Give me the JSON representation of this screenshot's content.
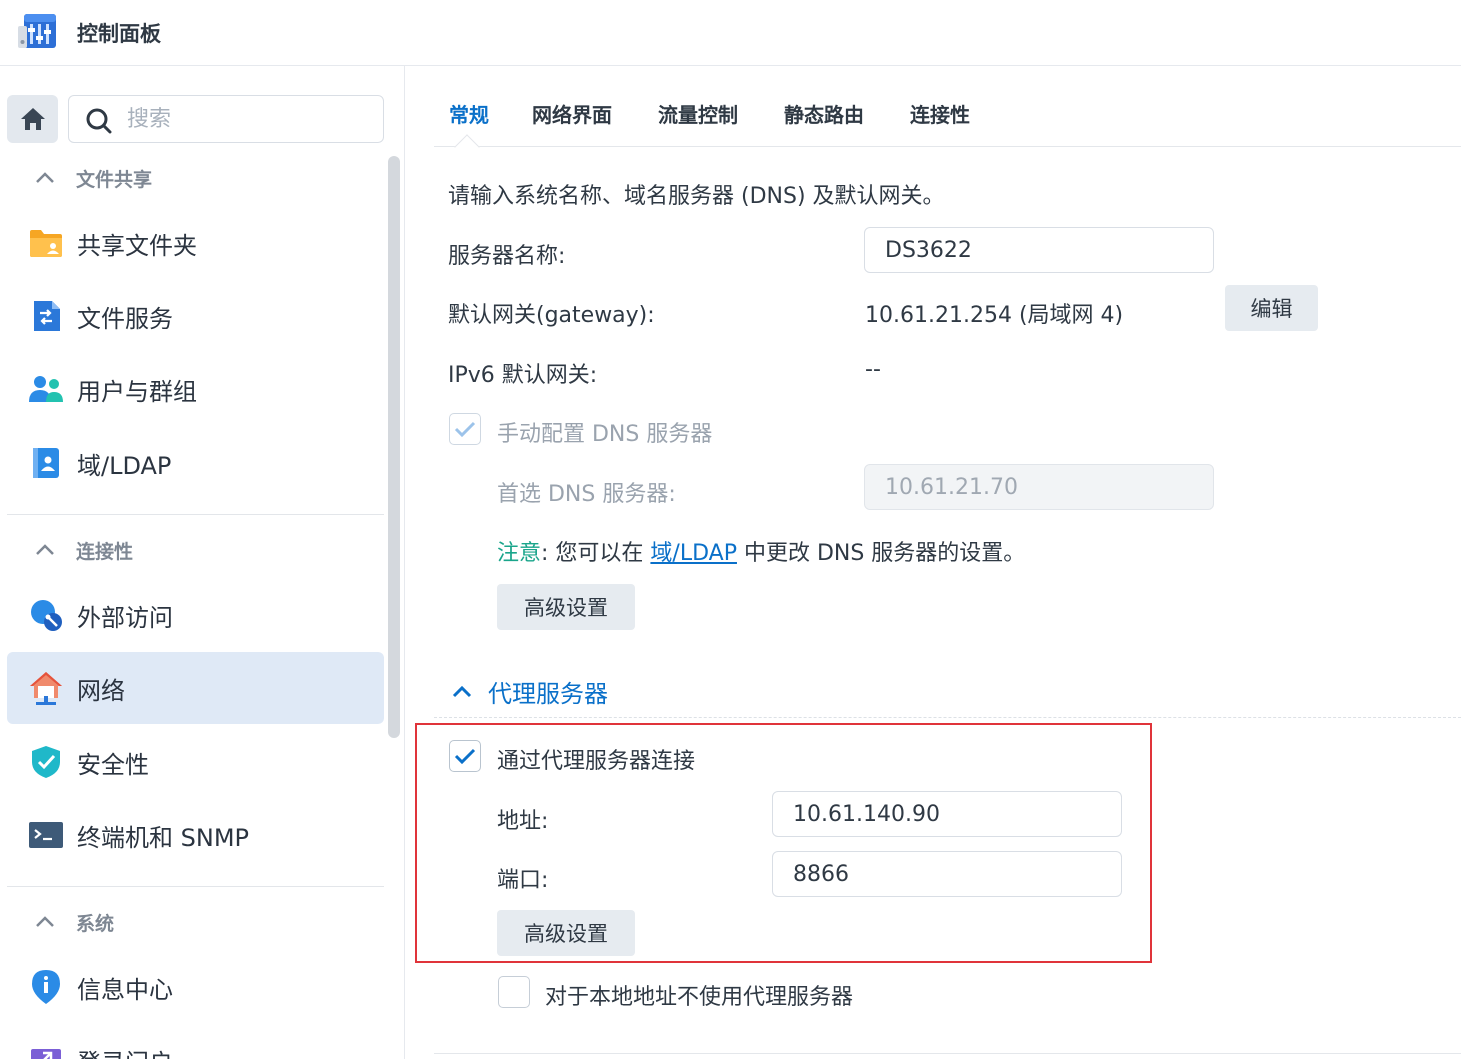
{
  "window": {
    "title": "控制面板"
  },
  "sidebar": {
    "search_placeholder": "搜索",
    "sections": [
      {
        "label": "文件共享"
      },
      {
        "label": "连接性"
      },
      {
        "label": "系统"
      }
    ],
    "items": [
      {
        "label": "共享文件夹",
        "icon": "shared-folder-icon"
      },
      {
        "label": "文件服务",
        "icon": "file-services-icon"
      },
      {
        "label": "用户与群组",
        "icon": "users-groups-icon"
      },
      {
        "label": "域/LDAP",
        "icon": "domain-ldap-icon"
      },
      {
        "label": "外部访问",
        "icon": "external-access-icon"
      },
      {
        "label": "网络",
        "icon": "network-icon",
        "active": true
      },
      {
        "label": "安全性",
        "icon": "security-shield-icon"
      },
      {
        "label": "终端机和 SNMP",
        "icon": "terminal-icon"
      },
      {
        "label": "信息中心",
        "icon": "info-center-icon"
      },
      {
        "label": "登录门户",
        "icon": "login-portal-icon"
      }
    ]
  },
  "tabs": [
    {
      "label": "常规",
      "active": true
    },
    {
      "label": "网络界面"
    },
    {
      "label": "流量控制"
    },
    {
      "label": "静态路由"
    },
    {
      "label": "连接性"
    }
  ],
  "general": {
    "intro": "请输入系统名称、域名服务器 (DNS) 及默认网关。",
    "server_name_label": "服务器名称:",
    "server_name_value": "DS3622",
    "gateway_label": "默认网关(gateway):",
    "gateway_value": "10.61.21.254 (局域网 4)",
    "edit_button": "编辑",
    "ipv6_gateway_label": "IPv6 默认网关:",
    "ipv6_gateway_value": "--",
    "manual_dns_label": "手动配置 DNS 服务器",
    "manual_dns_checked": true,
    "preferred_dns_label": "首选 DNS 服务器:",
    "preferred_dns_value": "10.61.21.70",
    "note_label": "注意",
    "note_text_before": ": 您可以在 ",
    "note_link": "域/LDAP",
    "note_text_after": " 中更改 DNS 服务器的设置。",
    "advanced_button": "高级设置"
  },
  "proxy": {
    "section_title": "代理服务器",
    "use_proxy_label": "通过代理服务器连接",
    "use_proxy_checked": true,
    "address_label": "地址:",
    "address_value": "10.61.140.90",
    "port_label": "端口:",
    "port_value": "8866",
    "advanced_button": "高级设置",
    "bypass_local_label": "对于本地地址不使用代理服务器",
    "bypass_local_checked": false
  },
  "colors": {
    "accent": "#0a70c9",
    "note": "#1aa58b",
    "highlight_box": "#e0343a",
    "active_nav_bg": "#dfe9f6"
  }
}
